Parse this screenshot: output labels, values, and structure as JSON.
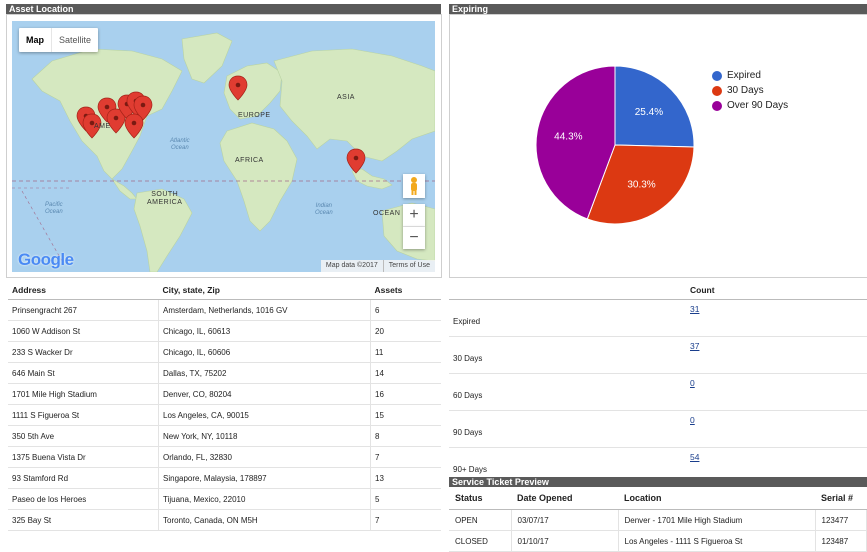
{
  "asset_location": {
    "title": "Asset Location",
    "map": {
      "map_type_active": "Map",
      "map_type_other": "Satellite",
      "labels": {
        "europe": "EUROPE",
        "asia": "ASIA",
        "africa": "AFRICA",
        "south_america": "SOUTH\nAMERICA",
        "north_america_partial": "AME",
        "atlantic": "Atlantic\nOcean",
        "pacific": "Pacific\nOcean",
        "indian": "Indian\nOcean",
        "oceania_partial": "OCEAN"
      },
      "zoom_in": "+",
      "zoom_out": "−",
      "logo": "Google",
      "map_data": "Map data ©2017",
      "terms": "Terms of Use",
      "pin_color": "#e03c31"
    },
    "table": {
      "headers": [
        "Address",
        "City, state, Zip",
        "Assets"
      ],
      "rows": [
        [
          "Prinsengracht 267",
          "Amsterdam, Netherlands, 1016 GV",
          "6"
        ],
        [
          "1060 W Addison St",
          "Chicago, IL, 60613",
          "20"
        ],
        [
          "233 S Wacker Dr",
          "Chicago, IL, 60606",
          "11"
        ],
        [
          "646 Main St",
          "Dallas, TX, 75202",
          "14"
        ],
        [
          "1701 Mile High Stadium",
          "Denver, CO, 80204",
          "16"
        ],
        [
          "1111 S Figueroa St",
          "Los Angeles, CA, 90015",
          "15"
        ],
        [
          "350 5th Ave",
          "New York, NY, 10118",
          "8"
        ],
        [
          "1375 Buena Vista Dr",
          "Orlando, FL, 32830",
          "7"
        ],
        [
          "93 Stamford Rd",
          "Singapore, Malaysia, 178897",
          "13"
        ],
        [
          "Paseo de los Heroes",
          "Tijuana, Mexico, 22010",
          "5"
        ],
        [
          "325 Bay St",
          "Toronto, Canada, ON M5H",
          "7"
        ]
      ]
    }
  },
  "expiring": {
    "title": "Expiring",
    "chart_data": {
      "type": "pie",
      "title": "",
      "slices": [
        {
          "label": "Expired",
          "value": 25.4,
          "text": "25.4%",
          "color": "#3366cc"
        },
        {
          "label": "30 Days",
          "value": 30.3,
          "text": "30.3%",
          "color": "#dc3912"
        },
        {
          "label": "Over 90 Days",
          "value": 44.3,
          "text": "44.3%",
          "color": "#990099"
        }
      ],
      "legend_position": "right"
    },
    "table": {
      "count_header": "Count",
      "rows": [
        {
          "label": "Expired",
          "count": "31"
        },
        {
          "label": "30 Days",
          "count": "37"
        },
        {
          "label": "60 Days",
          "count": "0"
        },
        {
          "label": "90 Days",
          "count": "0"
        },
        {
          "label": "90+ Days",
          "count": "54"
        }
      ]
    }
  },
  "service_tickets": {
    "title": "Service Ticket Preview",
    "headers": [
      "Status",
      "Date Opened",
      "Location",
      "Serial #"
    ],
    "rows": [
      [
        "OPEN",
        "03/07/17",
        "Denver - 1701 Mile High Stadium",
        "123477"
      ],
      [
        "CLOSED",
        "01/10/17",
        "Los Angeles - 1111 S Figueroa St",
        "123487"
      ]
    ]
  }
}
